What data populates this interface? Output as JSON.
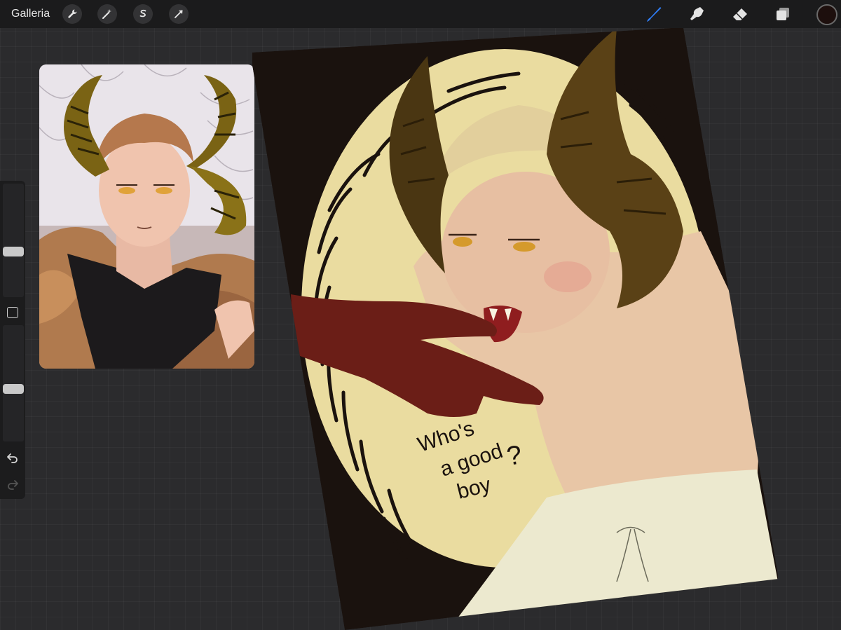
{
  "toolbar": {
    "gallery_label": "Galleria",
    "left_tools": [
      "wrench-icon",
      "magic-wand-icon",
      "selection-icon",
      "transform-icon"
    ],
    "right_tools": [
      "brush-icon",
      "smudge-icon",
      "eraser-icon",
      "layers-icon"
    ],
    "active_tool": "brush-icon",
    "active_color": "#1d0f0d",
    "accent": "#2f7df6"
  },
  "sidebar": {
    "size_slider_value": 0.39,
    "opacity_slider_value": 0.45,
    "controls": [
      "modify-button",
      "undo-icon",
      "redo-icon"
    ]
  },
  "canvas": {
    "artwork_text": [
      "Who's",
      "a good",
      "boy",
      "?"
    ]
  }
}
